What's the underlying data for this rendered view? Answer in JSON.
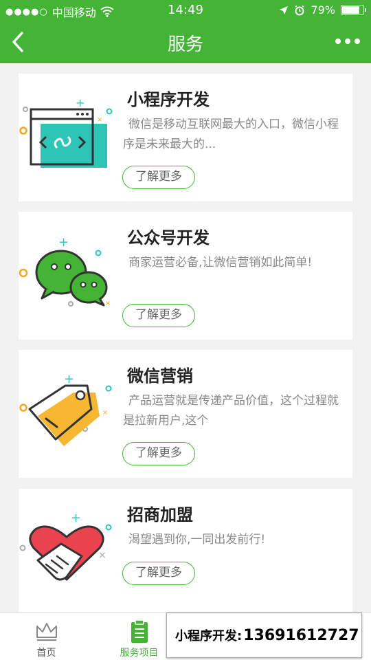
{
  "status_bar": {
    "signal_dots": "●●●●○",
    "carrier": "中国移动",
    "time": "14:49",
    "battery_percent": "79%",
    "battery_level": 0.79
  },
  "nav": {
    "title": "服务",
    "back_icon": "chevron-left-icon",
    "more_icon": "more-dots-icon"
  },
  "cards": [
    {
      "title": "小程序开发",
      "desc": "微信是移动互联网最大的入口，微信小程序是未来最大的...",
      "button": "了解更多",
      "icon": "mini-program-window-icon"
    },
    {
      "title": "公众号开发",
      "desc": "商家运营必备,让微信营销如此简单!",
      "button": "了解更多",
      "icon": "wechat-bubbles-icon"
    },
    {
      "title": "微信营销",
      "desc": "产品运营就是传递产品价值，这个过程就是拉新用户,这个",
      "button": "了解更多",
      "icon": "price-tag-icon"
    },
    {
      "title": "招商加盟",
      "desc": "渴望遇到你,一同出发前行!",
      "button": "了解更多",
      "icon": "handshake-heart-icon"
    }
  ],
  "tabs": [
    {
      "label": "首页",
      "icon": "crown-icon",
      "active": false
    },
    {
      "label": "服务项目",
      "icon": "clipboard-icon",
      "active": true
    }
  ],
  "promo": {
    "label": "小程序开发:",
    "phone": "13691612727"
  },
  "colors": {
    "brand_green": "#44b436",
    "teal": "#2ec4b6",
    "orange": "#f5a623",
    "red": "#e8434f",
    "yellow": "#f7b733"
  }
}
